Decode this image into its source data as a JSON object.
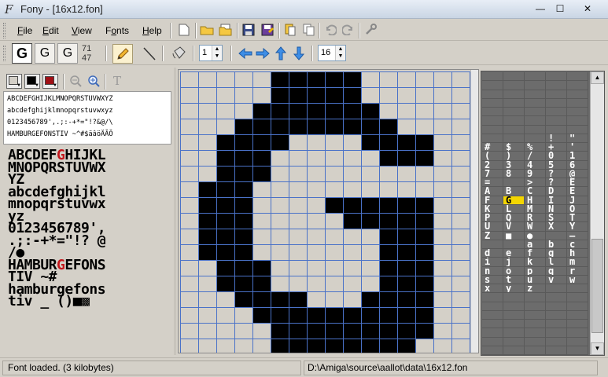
{
  "window": {
    "title": "Fony - [16x12.fon]",
    "minimize": "—",
    "maximize": "☐",
    "close": "✕"
  },
  "menu": {
    "items": [
      {
        "label": "File",
        "key": "F"
      },
      {
        "label": "Edit",
        "key": "E"
      },
      {
        "label": "View",
        "key": "V"
      },
      {
        "label": "Fonts",
        "key": "o"
      },
      {
        "label": "Help",
        "key": "H"
      }
    ]
  },
  "toolbar2": {
    "glyph_buttons": [
      "G",
      "G",
      "G"
    ],
    "dims_width": "71",
    "dims_height": "47",
    "brush_size": "1",
    "step_size": "16"
  },
  "left_panel": {
    "sample_lines": [
      "ABCDEFGHIJKLMNOPQRSTUVWXYZ",
      "abcdefghijklmnopqrstuvwxyz",
      "0123456789',.;:-+*=\"!?&@/\\",
      "HAMBURGEFONSTIV ~^#$äâöÄÃÖ"
    ],
    "big_sample_lines": [
      {
        "pre": "ABCDEF",
        "red": "G",
        "post": "HIJKL"
      },
      {
        "pre": "MNOPQRSTUVWX",
        "red": "",
        "post": ""
      },
      {
        "pre": "YZ",
        "red": "",
        "post": ""
      },
      {
        "pre": "abcdefghijkl",
        "red": "",
        "post": ""
      },
      {
        "pre": "mnopqrstuvwx",
        "red": "",
        "post": ""
      },
      {
        "pre": "yz",
        "red": "",
        "post": ""
      },
      {
        "pre": "0123456789',",
        "red": "",
        "post": ""
      },
      {
        "pre": ".;:-+*=\"!? @",
        "red": "",
        "post": ""
      },
      {
        "pre": "/●",
        "red": "",
        "post": ""
      },
      {
        "pre": "HAMBUR",
        "red": "G",
        "post": "EFONS"
      },
      {
        "pre": "TIV ~#",
        "red": "",
        "post": ""
      },
      {
        "pre": "hamburgefons",
        "red": "",
        "post": ""
      },
      {
        "pre": "tiv _ ()■▩",
        "red": "",
        "post": ""
      }
    ]
  },
  "editor": {
    "cols": 16,
    "rows": 18,
    "bitmap": [
      "0000011111000000",
      "0000011111000000",
      "0000111111100000",
      "0001111111110000",
      "0011110000111100",
      "0011100000011100",
      "0011100000000000",
      "0111000000000000",
      "0111000011111100",
      "0111000001111100",
      "0111000000011100",
      "0111000000011100",
      "0011100000011100",
      "0011100000011100",
      "0001111000111100",
      "0000111111111100",
      "0000011111111100",
      "0000011111111000"
    ]
  },
  "charmap": {
    "rows": [
      [
        "",
        "",
        "",
        "",
        ""
      ],
      [
        "",
        "",
        "",
        "",
        ""
      ],
      [
        "",
        "",
        "",
        "",
        ""
      ],
      [
        "",
        "",
        "",
        "",
        ""
      ],
      [
        "",
        "",
        "",
        "",
        ""
      ],
      [
        "",
        "",
        "",
        "",
        ""
      ],
      [
        "",
        "",
        "",
        "",
        ""
      ],
      [
        "",
        "",
        "",
        "!",
        "\""
      ],
      [
        "#",
        "$",
        "%",
        "+",
        "'"
      ],
      [
        "(",
        ")",
        "/",
        "0",
        "1"
      ],
      [
        "2",
        "3",
        "4",
        "5",
        "6"
      ],
      [
        "7",
        "8",
        "9",
        "?",
        "@"
      ],
      [
        "=",
        "",
        ">",
        "?",
        "E"
      ],
      [
        "A",
        "B",
        "C",
        "D",
        "E"
      ],
      [
        "F",
        "G",
        "H",
        "I",
        "J"
      ],
      [
        "K",
        "L",
        "M",
        "N",
        "O"
      ],
      [
        "P",
        "Q",
        "R",
        "S",
        "T"
      ],
      [
        "U",
        "V",
        "W",
        "X",
        "Y"
      ],
      [
        "Z",
        "■",
        "●",
        "",
        "—"
      ],
      [
        "",
        "",
        "a",
        "b",
        "c"
      ],
      [
        "d",
        "e",
        "f",
        "g",
        "h"
      ],
      [
        "i",
        "j",
        "k",
        "l",
        "m"
      ],
      [
        "n",
        "o",
        "p",
        "q",
        "r"
      ],
      [
        "s",
        "t",
        "u",
        "v",
        "w"
      ],
      [
        "x",
        "y",
        "z",
        "",
        ""
      ],
      [
        "",
        "",
        "",
        "",
        ""
      ],
      [
        "",
        "",
        "",
        "",
        ""
      ],
      [
        "",
        "",
        "",
        "",
        ""
      ],
      [
        "",
        "",
        "",
        "",
        ""
      ],
      [
        "",
        "",
        "",
        "",
        ""
      ],
      [
        "",
        "",
        "",
        "",
        ""
      ],
      [
        "",
        "",
        "",
        "",
        ""
      ]
    ],
    "selected": "G"
  },
  "status": {
    "message": "Font loaded. (3 kilobytes)",
    "path": "D:\\Amiga\\source\\aallot\\data\\16x12.fon"
  },
  "colors": {
    "ink": "#000000",
    "paper": "#d4d0c8",
    "grid": "#4a72c8",
    "accent_red": "#c4171c",
    "highlight": "#f4d600"
  },
  "icons": [
    "new-icon",
    "open-icon",
    "open-multiple-icon",
    "save-icon",
    "save-as-icon",
    "cut-icon",
    "copy-icon",
    "undo-icon",
    "redo-icon",
    "settings-icon",
    "pencil-icon",
    "line-icon",
    "fill-icon",
    "arrow-left-icon",
    "arrow-right-icon",
    "arrow-up-icon",
    "arrow-down-icon",
    "zoom-out-icon",
    "zoom-in-icon",
    "text-icon"
  ]
}
